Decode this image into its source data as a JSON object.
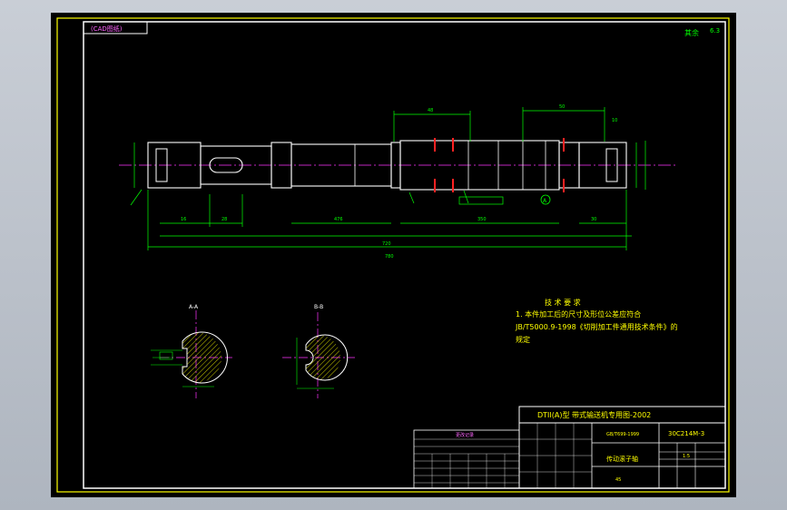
{
  "drawing": {
    "title_tab": "(CAD图纸)",
    "corner_mark": "其余",
    "corner_roughness": "6.3",
    "tech_requirements": {
      "heading": "技 术 要 求",
      "line1": "1. 本件加工后的尺寸及形位公差应符合",
      "line2": "JB/T5000.9-1998《切削加工件通用技术条件》的",
      "line3": "规定"
    },
    "sections": {
      "a": "A-A",
      "b": "B-B"
    },
    "dimensions": {
      "overall_length": "780",
      "total_span": "720",
      "left_seg": "16",
      "key_len": "28",
      "mid_len": "476",
      "right_seg_a": "30",
      "right_seg_b": "350",
      "top_dim_left": "48",
      "top_dim_right": "50",
      "small_a": "10",
      "datum_label": "A"
    },
    "title_block": {
      "project": "DTII(A)型  带式输送机专用图-2002",
      "drawing_no": "30C214M-3",
      "part_name": "传动滚子轴",
      "material": "45",
      "standard": "GB/T699-1999",
      "scale": "1:5",
      "weight": "",
      "revision_header": "更改记录"
    }
  }
}
